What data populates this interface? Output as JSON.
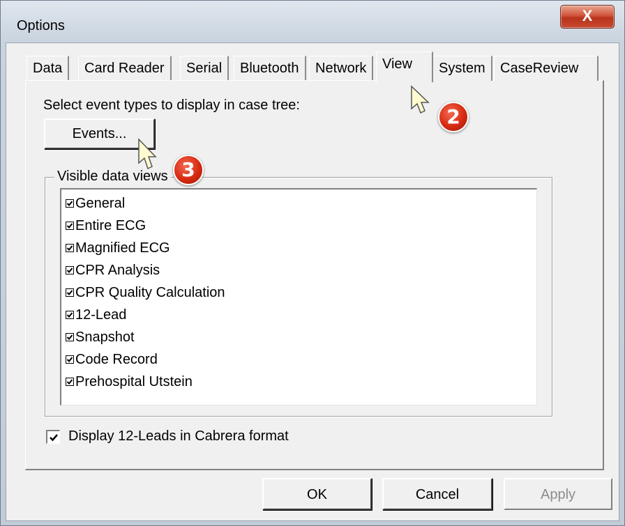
{
  "window": {
    "title": "Options",
    "close_label": "X"
  },
  "tabs": [
    {
      "label": "Data"
    },
    {
      "label": "Card Reader"
    },
    {
      "label": "Serial"
    },
    {
      "label": "Bluetooth"
    },
    {
      "label": "Network"
    },
    {
      "label": "View",
      "active": true
    },
    {
      "label": "System"
    },
    {
      "label": "CaseReview"
    }
  ],
  "view": {
    "events_prompt": "Select event types to display in case tree:",
    "events_button": "Events...",
    "visible_views_title": "Visible data views",
    "data_views": [
      {
        "label": "General",
        "checked": true
      },
      {
        "label": "Entire ECG",
        "checked": true
      },
      {
        "label": "Magnified ECG",
        "checked": true
      },
      {
        "label": "CPR Analysis",
        "checked": true
      },
      {
        "label": "CPR Quality Calculation",
        "checked": true
      },
      {
        "label": "12-Lead",
        "checked": true
      },
      {
        "label": "Snapshot",
        "checked": true
      },
      {
        "label": "Code Record",
        "checked": true
      },
      {
        "label": "Prehospital Utstein",
        "checked": true
      }
    ],
    "cabrera_label": "Display 12-Leads in Cabrera format",
    "cabrera_checked": true
  },
  "footer": {
    "ok_label": "OK",
    "cancel_label": "Cancel",
    "apply_label": "Apply"
  },
  "annotations": [
    {
      "number": "2"
    },
    {
      "number": "3"
    }
  ],
  "colors": {
    "callout": "#d72a12",
    "close_button": "#c84a2f",
    "dialog_bg": "#f0f0f0"
  }
}
